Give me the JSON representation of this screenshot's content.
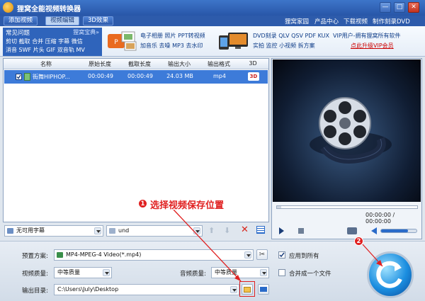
{
  "app": {
    "title": "狸窝全能视频转换器"
  },
  "toolbar": {
    "tabs": [
      "添加视频",
      "视频编辑",
      "3D效果"
    ],
    "links": [
      "狸窝家园",
      "产品中心",
      "下载视频",
      "制作刻录DVD"
    ]
  },
  "promo": {
    "faq_title": "常见问题",
    "faq_brand": "狸窝宝典»",
    "faq_lines": [
      "剪切 截取 合并 压缩 字幕 微信",
      "消音 SWF 片头 GIF 双音轨 MV"
    ],
    "block1_lines": [
      "电子相册 照片 PPT转视频",
      "加音乐 去噪 MP3 去水印"
    ],
    "block2_lines": [
      "DVD刻录 QLV QSV PDF KUX",
      "实拍 监控 小视频 拆方案"
    ],
    "vip_line1": "VIP用户-拥有狸窝所有软件",
    "vip_line2": "点此升级VIP会员"
  },
  "file_table": {
    "columns": [
      "名称",
      "原始长度",
      "截取长度",
      "输出大小",
      "输出格式",
      "3D"
    ],
    "rows": [
      {
        "name": "街舞HIPHOP...",
        "original_length": "00:00:49",
        "clip_length": "00:00:49",
        "output_size": "24.03 MB",
        "output_format": "mp4",
        "3d": "3D"
      }
    ]
  },
  "file_toolbar": {
    "subtitle": "无可用字幕",
    "audio_track": "und"
  },
  "preview": {
    "time": "00:00:00 / 00:00:00",
    "volume": 0.75
  },
  "settings": {
    "preset_label": "预置方案:",
    "preset_value": "MP4-MPEG-4 Video(*.mp4)",
    "apply_all_label": "应用到所有",
    "apply_all_checked": true,
    "video_quality_label": "视频质量:",
    "video_quality_value": "中等质量",
    "audio_quality_label": "音频质量:",
    "audio_quality_value": "中等质量",
    "merge_label": "合并成一个文件",
    "merge_checked": false,
    "output_label": "输出目录:",
    "output_value": "C:\\Users\\July\\Desktop"
  },
  "annotation": {
    "badge1": "1",
    "callout": "选择视频保存位置",
    "badge2": "2"
  },
  "colors": {
    "title_bar": "#2d5bab",
    "selection": "#3d7bd9",
    "accent_red": "#e02020",
    "vip_red": "#cc0000"
  }
}
